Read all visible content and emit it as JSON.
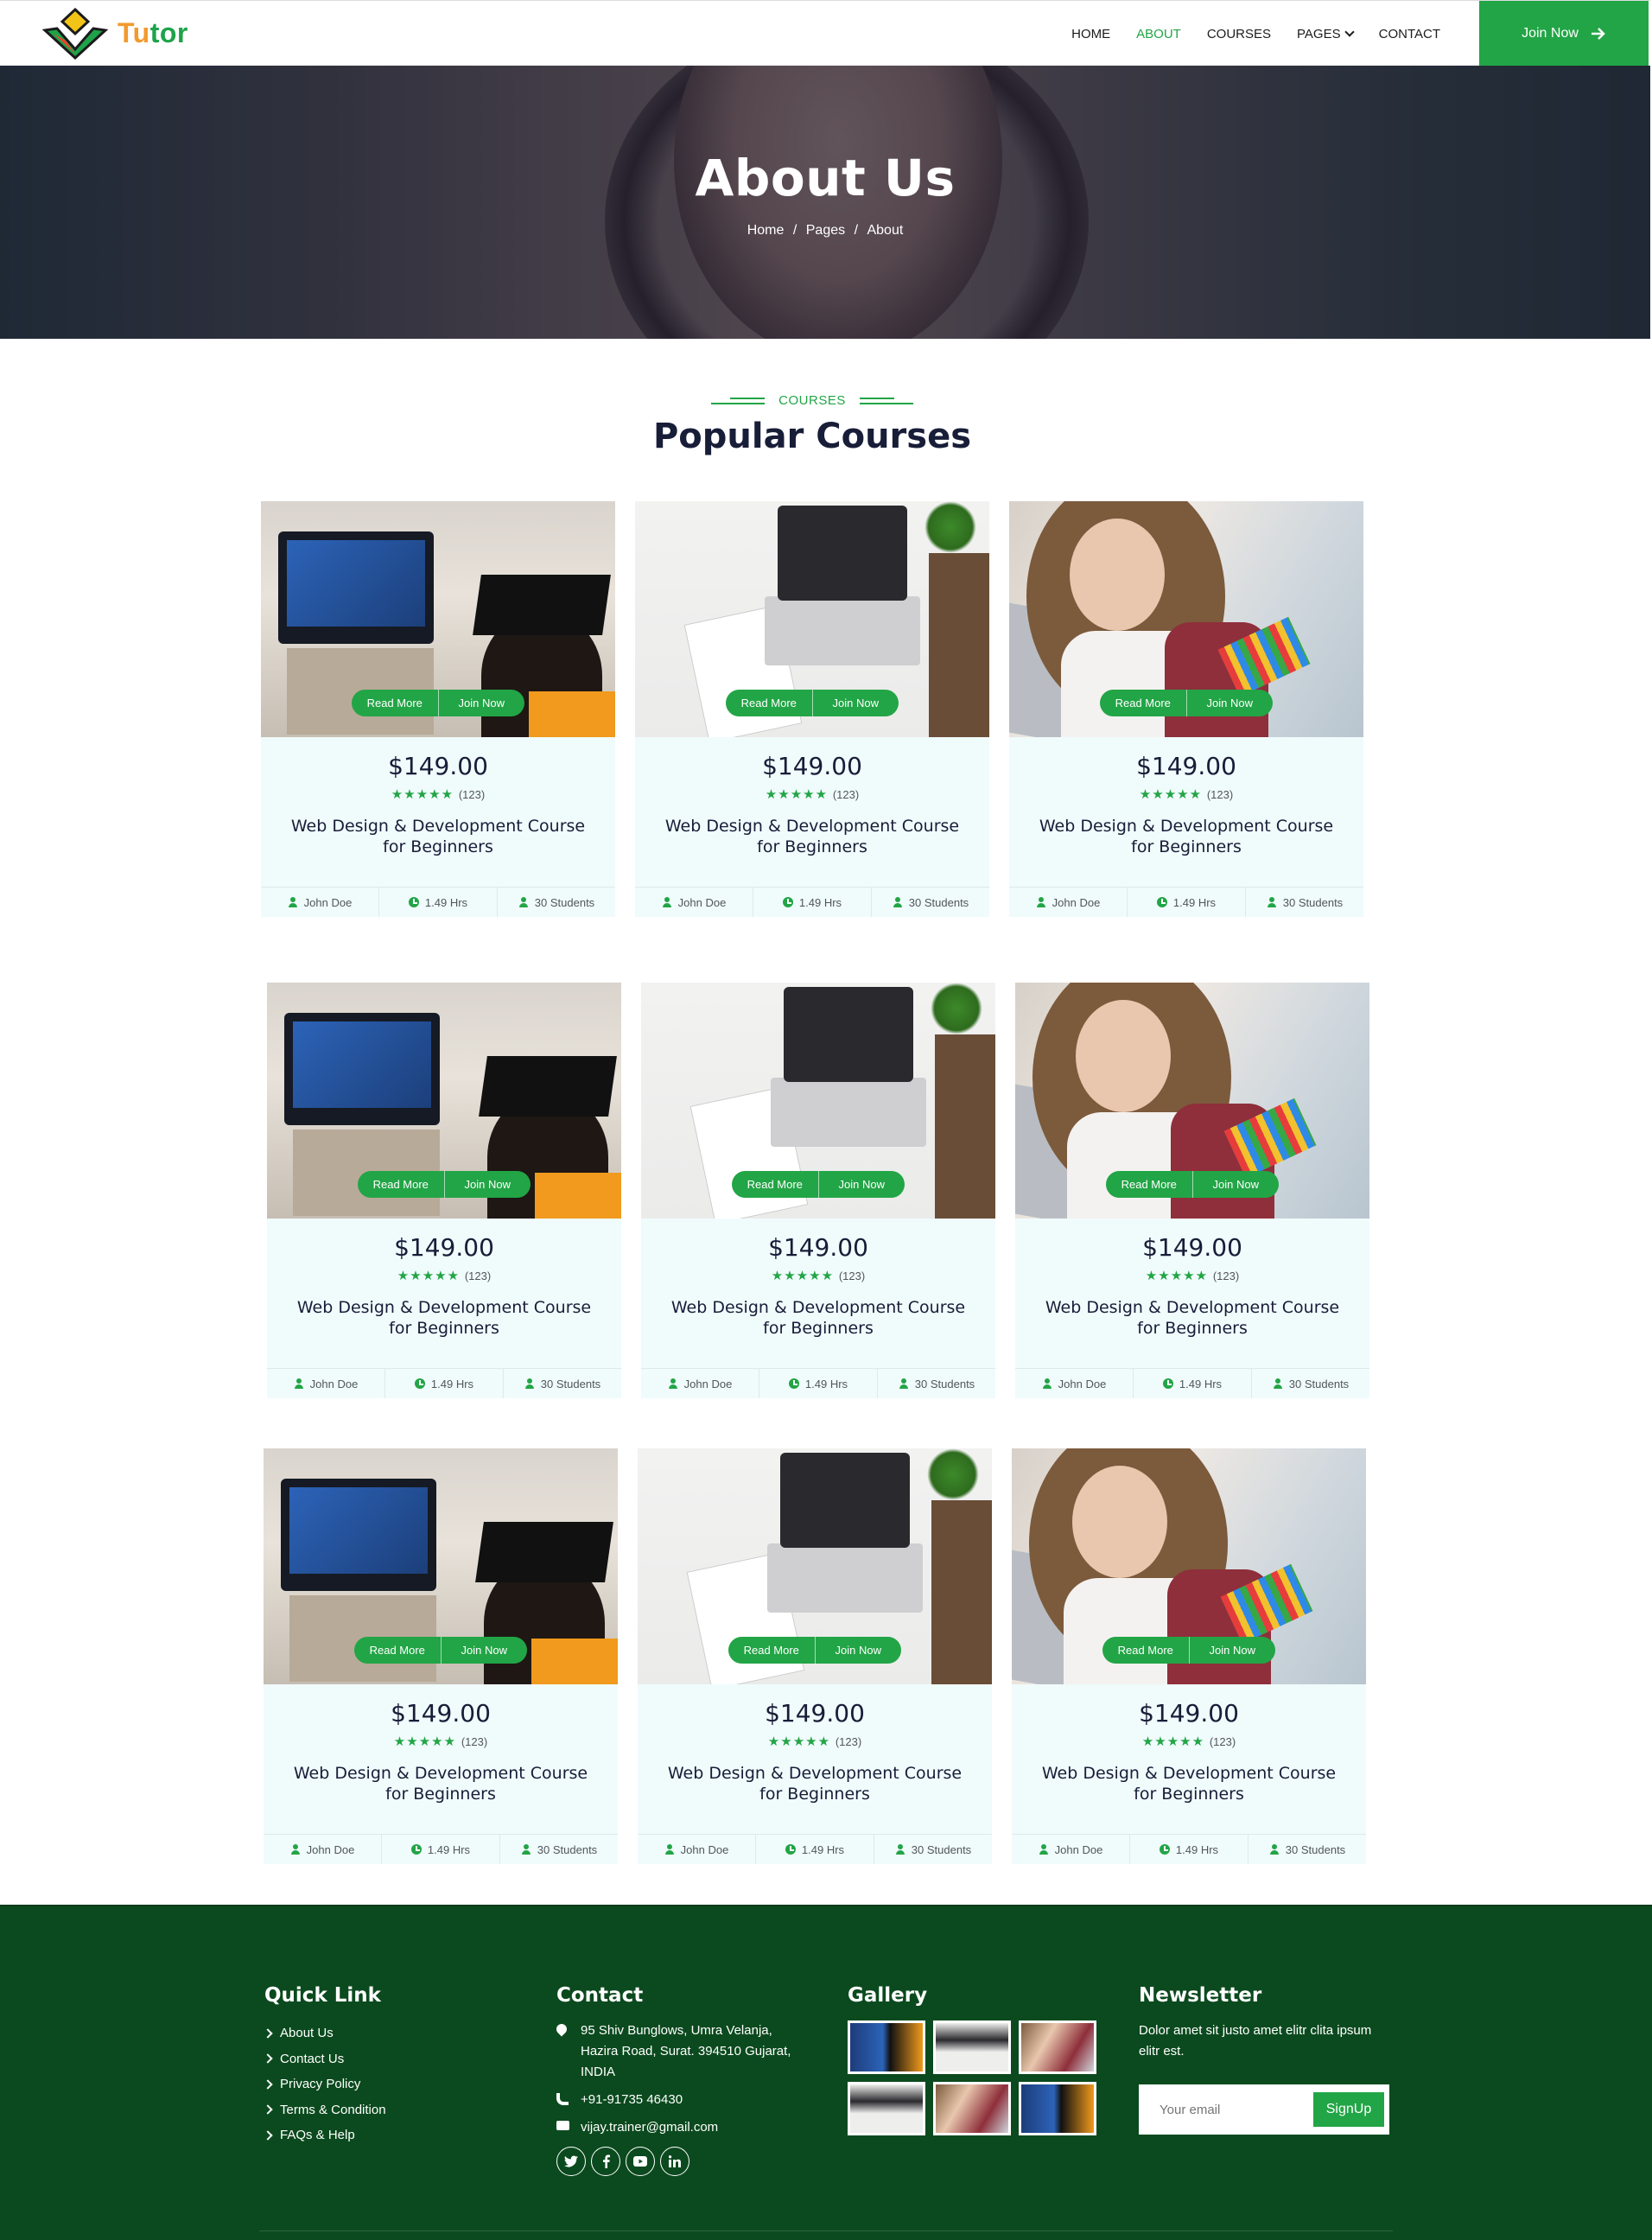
{
  "brand": {
    "name_part1": "Tu",
    "name_part2": "tor"
  },
  "nav": {
    "items": [
      {
        "label": "HOME"
      },
      {
        "label": "ABOUT"
      },
      {
        "label": "COURSES"
      },
      {
        "label": "PAGES"
      },
      {
        "label": "CONTACT"
      }
    ],
    "active": "ABOUT",
    "cta_label": "Join Now"
  },
  "hero": {
    "title": "About Us",
    "breadcrumb": [
      "Home",
      "Pages",
      "About"
    ],
    "separator": "/"
  },
  "section": {
    "subtitle": "COURSES",
    "title": "Popular Courses"
  },
  "courses": [
    {
      "price": "$149.00",
      "reviews": "(123)",
      "title": "Web Design & Development Course for Beginners",
      "instructor": "John Doe",
      "duration": "1.49 Hrs",
      "students": "30 Students",
      "read_more": "Read More",
      "join_now": "Join Now",
      "image": "graduation-tv"
    },
    {
      "price": "$149.00",
      "reviews": "(123)",
      "title": "Web Design & Development Course for Beginners",
      "instructor": "John Doe",
      "duration": "1.49 Hrs",
      "students": "30 Students",
      "read_more": "Read More",
      "join_now": "Join Now",
      "image": "laptop-desk"
    },
    {
      "price": "$149.00",
      "reviews": "(123)",
      "title": "Web Design & Development Course for Beginners",
      "instructor": "John Doe",
      "duration": "1.49 Hrs",
      "students": "30 Students",
      "read_more": "Read More",
      "join_now": "Join Now",
      "image": "woman-pencil"
    },
    {
      "price": "$149.00",
      "reviews": "(123)",
      "title": "Web Design & Development Course for Beginners",
      "instructor": "John Doe",
      "duration": "1.49 Hrs",
      "students": "30 Students",
      "read_more": "Read More",
      "join_now": "Join Now",
      "image": "graduation-tv"
    },
    {
      "price": "$149.00",
      "reviews": "(123)",
      "title": "Web Design & Development Course for Beginners",
      "instructor": "John Doe",
      "duration": "1.49 Hrs",
      "students": "30 Students",
      "read_more": "Read More",
      "join_now": "Join Now",
      "image": "laptop-desk"
    },
    {
      "price": "$149.00",
      "reviews": "(123)",
      "title": "Web Design & Development Course for Beginners",
      "instructor": "John Doe",
      "duration": "1.49 Hrs",
      "students": "30 Students",
      "read_more": "Read More",
      "join_now": "Join Now",
      "image": "woman-pencil"
    },
    {
      "price": "$149.00",
      "reviews": "(123)",
      "title": "Web Design & Development Course for Beginners",
      "instructor": "John Doe",
      "duration": "1.49 Hrs",
      "students": "30 Students",
      "read_more": "Read More",
      "join_now": "Join Now",
      "image": "graduation-tv"
    },
    {
      "price": "$149.00",
      "reviews": "(123)",
      "title": "Web Design & Development Course for Beginners",
      "instructor": "John Doe",
      "duration": "1.49 Hrs",
      "students": "30 Students",
      "read_more": "Read More",
      "join_now": "Join Now",
      "image": "laptop-desk"
    },
    {
      "price": "$149.00",
      "reviews": "(123)",
      "title": "Web Design & Development Course for Beginners",
      "instructor": "John Doe",
      "duration": "1.49 Hrs",
      "students": "30 Students",
      "read_more": "Read More",
      "join_now": "Join Now",
      "image": "woman-pencil"
    }
  ],
  "rating_stars": 5,
  "footer": {
    "quick_link": {
      "heading": "Quick Link",
      "links": [
        "About Us",
        "Contact Us",
        "Privacy Policy",
        "Terms & Condition",
        "FAQs & Help"
      ]
    },
    "contact": {
      "heading": "Contact",
      "address": "95 Shiv Bunglows, Umra Velanja, Hazira Road, Surat. 394510 Gujarat, INDIA",
      "phone": "+91-91735 46430",
      "email": "vijay.trainer@gmail.com",
      "socials": [
        "twitter-icon",
        "facebook-icon",
        "youtube-icon",
        "linkedin-icon"
      ]
    },
    "gallery": {
      "heading": "Gallery",
      "images": [
        "graduation-tv",
        "laptop-desk",
        "woman-pencil",
        "laptop-desk",
        "woman-pencil",
        "graduation-tv"
      ]
    },
    "newsletter": {
      "heading": "Newsletter",
      "text": "Dolor amet sit justo amet elitr clita ipsum elitr est.",
      "placeholder": "Your email",
      "button": "SignUp"
    }
  },
  "colors": {
    "primary": "#22a546",
    "dark": "#181d38",
    "footer_bg": "#0b4a1e",
    "card_bg": "#f0fbfc"
  }
}
